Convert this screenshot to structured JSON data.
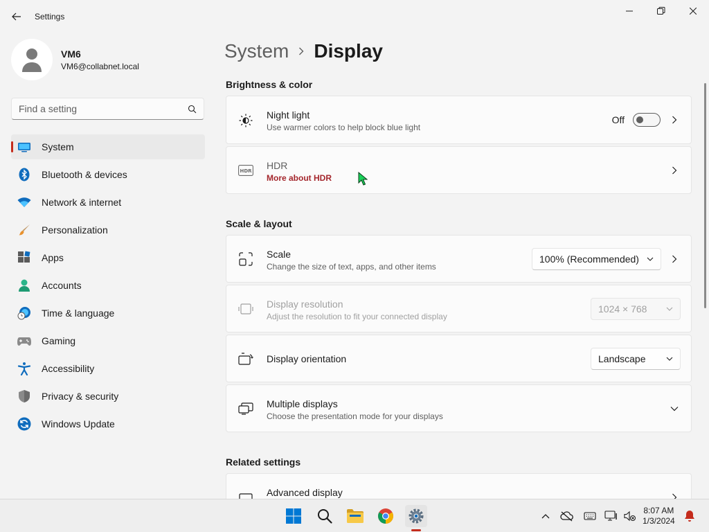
{
  "window": {
    "title": "Settings"
  },
  "profile": {
    "name": "VM6",
    "email": "VM6@collabnet.local"
  },
  "search": {
    "placeholder": "Find a setting"
  },
  "sidebar": {
    "items": [
      {
        "label": "System",
        "icon": "system-icon",
        "active": true
      },
      {
        "label": "Bluetooth & devices",
        "icon": "bluetooth-icon"
      },
      {
        "label": "Network & internet",
        "icon": "wifi-icon"
      },
      {
        "label": "Personalization",
        "icon": "brush-icon"
      },
      {
        "label": "Apps",
        "icon": "apps-icon"
      },
      {
        "label": "Accounts",
        "icon": "person-icon"
      },
      {
        "label": "Time & language",
        "icon": "globe-clock-icon"
      },
      {
        "label": "Gaming",
        "icon": "gamepad-icon"
      },
      {
        "label": "Accessibility",
        "icon": "accessibility-icon"
      },
      {
        "label": "Privacy & security",
        "icon": "shield-icon"
      },
      {
        "label": "Windows Update",
        "icon": "refresh-icon"
      }
    ]
  },
  "breadcrumb": {
    "parent": "System",
    "current": "Display"
  },
  "sections": {
    "brightness": "Brightness & color",
    "scale": "Scale & layout",
    "related": "Related settings"
  },
  "night_light": {
    "title": "Night light",
    "subtitle": "Use warmer colors to help block blue light",
    "state_label": "Off",
    "on": false
  },
  "hdr": {
    "title": "HDR",
    "link": "More about HDR"
  },
  "scale": {
    "title": "Scale",
    "subtitle": "Change the size of text, apps, and other items",
    "value": "100% (Recommended)"
  },
  "resolution": {
    "title": "Display resolution",
    "subtitle": "Adjust the resolution to fit your connected display",
    "value": "1024 × 768",
    "disabled": true
  },
  "orientation": {
    "title": "Display orientation",
    "value": "Landscape"
  },
  "multiple": {
    "title": "Multiple displays",
    "subtitle": "Choose the presentation mode for your displays"
  },
  "advanced": {
    "title": "Advanced display"
  },
  "taskbar": {
    "time": "8:07 AM",
    "date": "1/3/2024"
  },
  "colors": {
    "accent_red": "#c42b1c",
    "link": "#a4262c",
    "windows_blue": "#0078d4"
  }
}
